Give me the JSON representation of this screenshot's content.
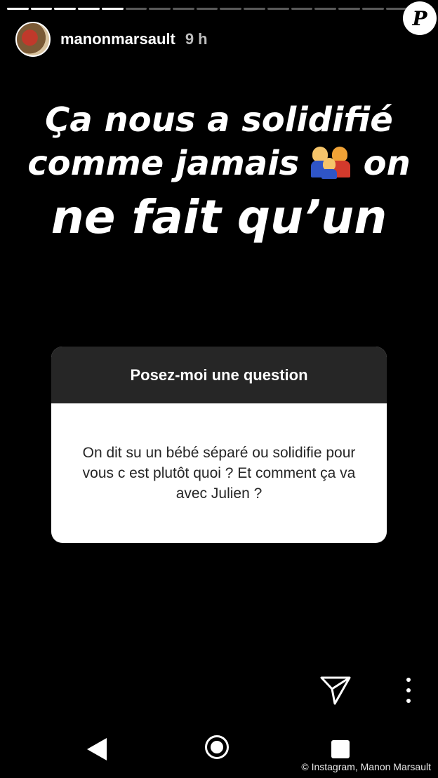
{
  "story": {
    "progress_total": 18,
    "progress_done": 5,
    "username": "manonmarsault",
    "time": "9 h"
  },
  "logo": {
    "letter": "P"
  },
  "headline": {
    "line1": "Ça nous a solidifié",
    "line2_a": "comme jamais",
    "line2_b": "on",
    "line2_emoji": "family-emoji",
    "line3": "ne fait qu’un"
  },
  "question": {
    "title": "Posez-moi une question",
    "body": "On dit su un bébé séparé ou solidifie pour vous c est plutôt quoi ? Et comment ça va avec Julien ?"
  },
  "credit": "© Instagram, Manon Marsault"
}
